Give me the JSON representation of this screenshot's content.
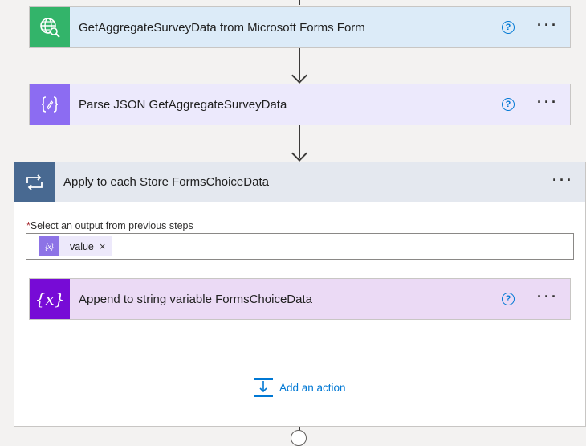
{
  "steps": [
    {
      "title": "GetAggregateSurveyData from Microsoft Forms Form",
      "icon": "globe-search-icon",
      "accent": "#33b46a",
      "background": "#dcebf8"
    },
    {
      "title": "Parse JSON GetAggregateSurveyData",
      "icon": "data-operation-icon",
      "accent": "#8c6cf2",
      "background": "#ece9fc"
    }
  ],
  "help_label": "?",
  "more_label": "···",
  "apply_each": {
    "title": "Apply to each Store FormsChoiceData",
    "icon": "loop-icon",
    "accent": "#486991",
    "header_background": "#e4e8ef",
    "field": {
      "required_mark": "*",
      "label": "Select an output from previous steps",
      "token": {
        "icon_text": "{x}",
        "label": "value",
        "remove": "×"
      }
    },
    "inner_action": {
      "title": "Append to string variable FormsChoiceData",
      "icon": "variable-icon",
      "icon_text": "{x}",
      "accent": "#770bd6",
      "background": "#ebdaf5"
    },
    "add_action_label": "Add an action"
  }
}
